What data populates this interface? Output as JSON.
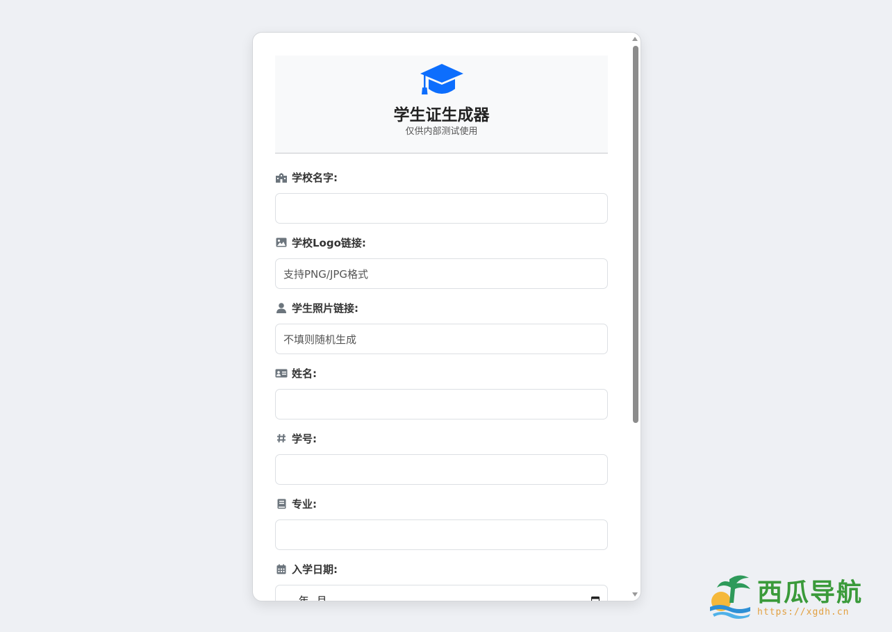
{
  "header": {
    "title": "学生证生成器",
    "subtitle": "仅供内部测试使用",
    "icon": "graduation-cap-icon",
    "accent_color": "#0d6efd"
  },
  "fields": [
    {
      "label": "学校名字:",
      "icon": "school-icon",
      "value": "",
      "placeholder": ""
    },
    {
      "label": "学校Logo链接:",
      "icon": "image-icon",
      "value": "",
      "placeholder": "支持PNG/JPG格式"
    },
    {
      "label": "学生照片链接:",
      "icon": "user-icon",
      "value": "",
      "placeholder": "不填则随机生成"
    },
    {
      "label": "姓名:",
      "icon": "id-card-icon",
      "value": "",
      "placeholder": ""
    },
    {
      "label": "学号:",
      "icon": "hash-icon",
      "value": "",
      "placeholder": ""
    },
    {
      "label": "专业:",
      "icon": "book-icon",
      "value": "",
      "placeholder": ""
    },
    {
      "label": "入学日期:",
      "icon": "calendar-icon",
      "value": "----年--月",
      "placeholder": ""
    }
  ],
  "watermark": {
    "title": "西瓜导航",
    "url": "https://xgdh.cn"
  }
}
